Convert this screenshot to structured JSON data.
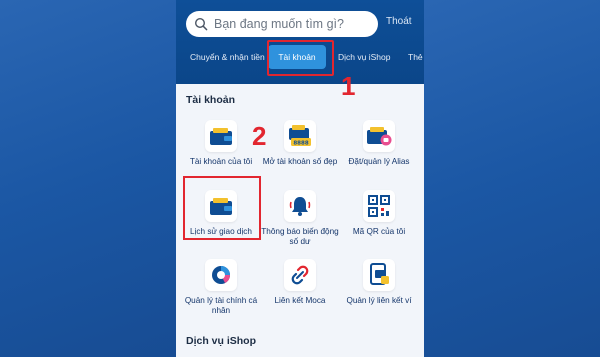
{
  "header": {
    "search_placeholder": "Bạn đang muốn tìm gì?",
    "logout_label": "Thoát"
  },
  "tabs": [
    {
      "label": "Chuyển & nhận tiền"
    },
    {
      "label": "Tài khoản",
      "active": true
    },
    {
      "label": "Dịch vụ iShop"
    },
    {
      "label": "Thẻ"
    }
  ],
  "sections": {
    "accounts_title": "Tài khoản",
    "ishop_title": "Dịch vụ iShop"
  },
  "items": [
    {
      "label": "Tài khoản của tôi",
      "icon": "wallet-icon"
    },
    {
      "label": "Mở tài khoản số đẹp",
      "icon": "wallet-number-icon"
    },
    {
      "label": "Đặt/quản lý Alias",
      "icon": "wallet-alias-icon"
    },
    {
      "label": "Lịch sử giao dịch",
      "icon": "wallet-history-icon"
    },
    {
      "label": "Thông báo biến động số dư",
      "icon": "bell-icon"
    },
    {
      "label": "Mã QR của tôi",
      "icon": "qr-code-icon"
    },
    {
      "label": "Quản lý tài chính cá nhân",
      "icon": "pie-chart-icon"
    },
    {
      "label": "Liên kết Moca",
      "icon": "link-icon"
    },
    {
      "label": "Quản lý liên kết ví",
      "icon": "wallet-link-icon"
    }
  ],
  "annotations": {
    "step1": "1",
    "step2": "2"
  },
  "colors": {
    "accent_red": "#e2262f",
    "header_blue": "#0e4f98",
    "active_tab": "#2f92dd",
    "text_blue": "#15366b"
  }
}
